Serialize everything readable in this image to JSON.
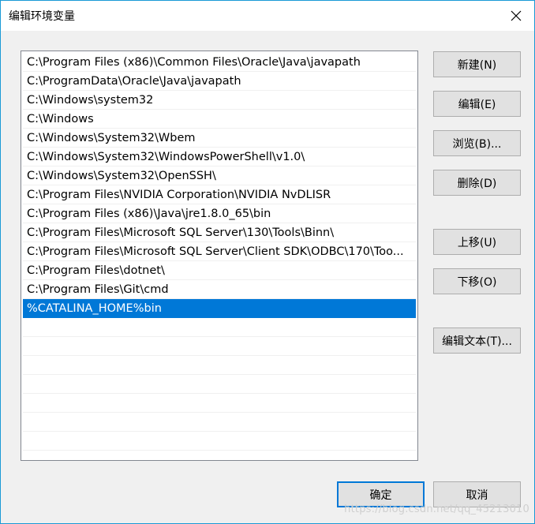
{
  "window": {
    "title": "编辑环境变量"
  },
  "list": {
    "items": [
      "C:\\Program Files (x86)\\Common Files\\Oracle\\Java\\javapath",
      "C:\\ProgramData\\Oracle\\Java\\javapath",
      "C:\\Windows\\system32",
      "C:\\Windows",
      "C:\\Windows\\System32\\Wbem",
      "C:\\Windows\\System32\\WindowsPowerShell\\v1.0\\",
      "C:\\Windows\\System32\\OpenSSH\\",
      "C:\\Program Files\\NVIDIA Corporation\\NVIDIA NvDLISR",
      "C:\\Program Files (x86)\\Java\\jre1.8.0_65\\bin",
      "C:\\Program Files\\Microsoft SQL Server\\130\\Tools\\Binn\\",
      "C:\\Program Files\\Microsoft SQL Server\\Client SDK\\ODBC\\170\\Too...",
      "C:\\Program Files\\dotnet\\",
      "C:\\Program Files\\Git\\cmd",
      "%CATALINA_HOME%bin"
    ],
    "selected_index": 13,
    "empty_rows": 8
  },
  "buttons": {
    "new": "新建(N)",
    "edit": "编辑(E)",
    "browse": "浏览(B)...",
    "delete": "删除(D)",
    "move_up": "上移(U)",
    "move_down": "下移(O)",
    "edit_text": "编辑文本(T)...",
    "ok": "确定",
    "cancel": "取消"
  },
  "watermark": "https://blog.csdn.net/qq_45213010",
  "colors": {
    "selection": "#0078d7",
    "window_border": "#1a9ad6",
    "dialog_bg": "#f0f0f0"
  },
  "icons": {
    "close": "close-icon"
  }
}
